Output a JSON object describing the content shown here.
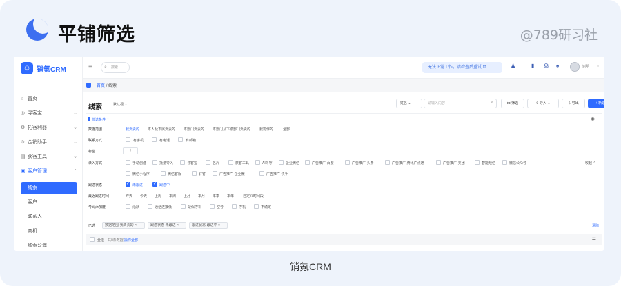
{
  "banner": {
    "feature_title": "平铺筛选",
    "watermark": "@789研习社"
  },
  "caption": "销氪CRM",
  "app": {
    "name": "销氪CRM",
    "logo_glyph": "☺"
  },
  "sidebar": {
    "items": [
      {
        "label": "首页",
        "icon": "home-icon",
        "glyph": "⌂"
      },
      {
        "label": "寻客宝",
        "icon": "compass-icon",
        "glyph": "◎",
        "chevron": "⌄"
      },
      {
        "label": "拓客利器",
        "icon": "tools-icon",
        "glyph": "⚙",
        "chevron": "⌄"
      },
      {
        "label": "企销助手",
        "icon": "assistant-icon",
        "glyph": "⊙",
        "chevron": "⌄"
      },
      {
        "label": "获客工具",
        "icon": "toolbox-icon",
        "glyph": "▤",
        "chevron": "⌄"
      },
      {
        "label": "客户管理",
        "icon": "customer-icon",
        "glyph": "▣",
        "chevron": "⌃"
      }
    ],
    "sub_items": [
      {
        "label": "线索",
        "selected": true
      },
      {
        "label": "客户"
      },
      {
        "label": "联系人"
      },
      {
        "label": "商机"
      },
      {
        "label": "线索公海"
      }
    ]
  },
  "header": {
    "menu_icon": "≡",
    "search_placeholder": "搜索",
    "notice": "无法正常工作，请检查后重试 ⊡",
    "icons": [
      "user-add-icon",
      "book-icon",
      "headset-icon",
      "bell-icon"
    ],
    "icon_glyphs": [
      "♟",
      "▮",
      "☊",
      "♠"
    ],
    "username": "谢明",
    "user_chevron": "⌄"
  },
  "breadcrumb": {
    "home": "首页",
    "separator": "/",
    "current": "线索"
  },
  "toolbar": {
    "title": "线索",
    "view_label": "默认视 ⌄",
    "search_field": "姓名 ⌄",
    "search_placeholder": "请输入内容",
    "search_icon": "⌕",
    "filter_label": "⋈ 筛选",
    "import_label": "⇪ 导入 ⌄",
    "export_label": "⇩ 导出",
    "new_label": "+ 新建"
  },
  "filters": {
    "header": "筛选条件 ⌃",
    "gear": "✺",
    "rows": [
      {
        "label": "数据范围",
        "type": "options",
        "options": [
          {
            "text": "我负责的",
            "on": true
          },
          {
            "text": "本人及下属负责的"
          },
          {
            "text": "本部门负责的"
          },
          {
            "text": "本部门及下级部门负责的"
          },
          {
            "text": "我协作的"
          },
          {
            "text": "全部"
          }
        ]
      },
      {
        "label": "联系方式",
        "type": "checks",
        "options": [
          {
            "text": "有手机"
          },
          {
            "text": "有电话"
          },
          {
            "text": "有邮箱"
          }
        ]
      },
      {
        "label": "标签",
        "type": "plus",
        "plus": "+"
      },
      {
        "label": "录入方式",
        "type": "checks",
        "options": [
          {
            "text": "手动创建"
          },
          {
            "text": "批量导入"
          },
          {
            "text": "寻客宝"
          },
          {
            "text": "名片"
          },
          {
            "text": "获客工具"
          },
          {
            "text": "AI外呼"
          },
          {
            "text": "企业微信"
          },
          {
            "text": "广告推广-百度"
          },
          {
            "text": "广告推广-头条"
          },
          {
            "text": "广告推广-腾讯广点通"
          },
          {
            "text": "广告推广-美团"
          },
          {
            "text": "智能短信"
          },
          {
            "text": "微信公众号"
          }
        ],
        "more": "收起 ⌃"
      },
      {
        "label": "",
        "type": "checks",
        "options": [
          {
            "text": "微信小程序"
          },
          {
            "text": "微信客服"
          },
          {
            "text": "钉钉"
          },
          {
            "text": "广告推广-企业微"
          },
          {
            "text": "广告推广-快手"
          }
        ]
      },
      {
        "label": "跟进状态",
        "type": "checks",
        "options": [
          {
            "text": "未跟进",
            "checked": true
          },
          {
            "text": "跟进中",
            "checked": true
          }
        ]
      },
      {
        "label": "最近跟进时间",
        "type": "options",
        "options": [
          {
            "text": "昨天"
          },
          {
            "text": "今天"
          },
          {
            "text": "上周"
          },
          {
            "text": "本周"
          },
          {
            "text": "上月"
          },
          {
            "text": "本月"
          },
          {
            "text": "本季"
          },
          {
            "text": "本年"
          },
          {
            "text": "自定义时间段"
          }
        ]
      },
      {
        "label": "号码添加度",
        "type": "checks",
        "options": [
          {
            "text": "活跃"
          },
          {
            "text": "通话连接低"
          },
          {
            "text": "疑似停机"
          },
          {
            "text": "空号"
          },
          {
            "text": "停机"
          },
          {
            "text": "不确定"
          }
        ]
      }
    ],
    "chosen_label": "已选",
    "chosen": [
      "数据范围-我负责的 ×",
      "跟进状态-未跟进 ×",
      "跟进状态-跟进中 ×"
    ],
    "clear": "清除"
  },
  "table": {
    "select_all": "全选",
    "count": "共0条数据",
    "operate": "操作全部",
    "columns_icon": "☰"
  }
}
